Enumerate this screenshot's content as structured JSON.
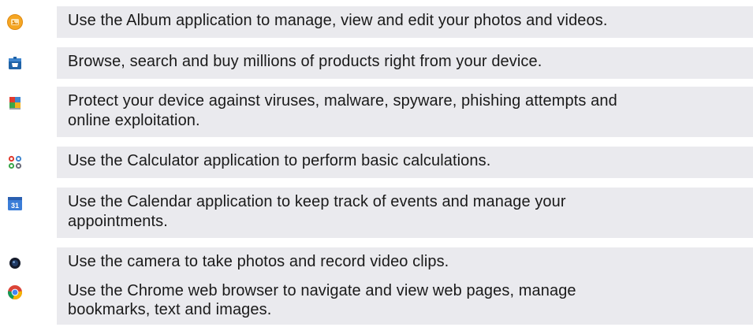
{
  "apps": [
    {
      "icon": "album-icon",
      "description": "Use the Album application to manage, view and edit your photos and videos."
    },
    {
      "icon": "store-bag-icon",
      "description": "Browse, search and buy millions of products right from your device."
    },
    {
      "icon": "antivirus-shield-icon",
      "description": "Protect your device against viruses, malware, spyware, phishing attempts and online exploitation."
    },
    {
      "icon": "calculator-icon",
      "description": "Use the Calculator application to perform basic calculations."
    },
    {
      "icon": "calendar-icon",
      "description": "Use the Calendar application to keep track of events and manage your appointments."
    },
    {
      "icon": "camera-icon",
      "description": "Use the camera to take photos and record video clips."
    },
    {
      "icon": "chrome-icon",
      "description": "Use the Chrome web browser to navigate and view web pages, manage bookmarks, text and images."
    }
  ],
  "calendar_icon_text": "31",
  "colors": {
    "row_background": "#eaeaee",
    "text": "#1a1a1a",
    "album_orange": "#f5a623",
    "store_blue": "#1f63a8",
    "calendar_blue": "#3b7dd8"
  }
}
